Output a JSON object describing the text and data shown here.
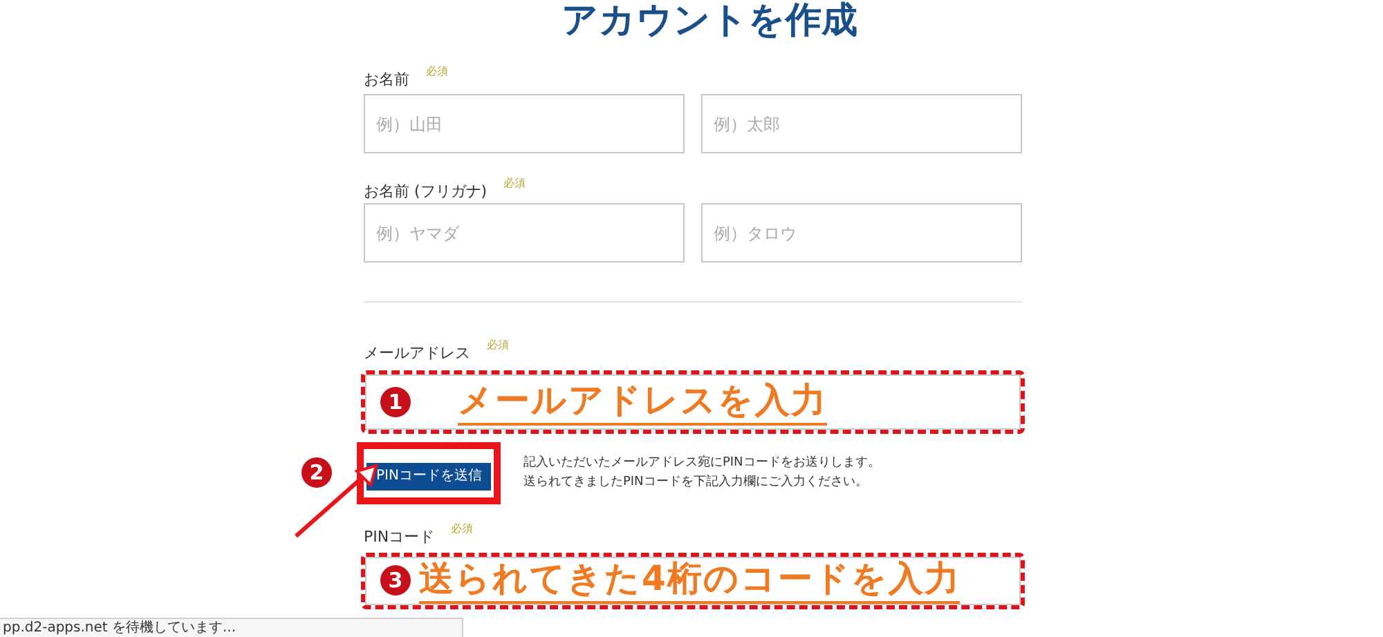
{
  "title": "アカウントを作成",
  "fields": [
    {
      "label": "お名前",
      "required": "必須",
      "inputs": [
        {
          "placeholder": "例）山田"
        },
        {
          "placeholder": "例）太郎"
        }
      ]
    },
    {
      "label": "お名前 (フリガナ)",
      "required": "必須",
      "inputs": [
        {
          "placeholder": "例）ヤマダ"
        },
        {
          "placeholder": "例）タロウ"
        }
      ]
    }
  ],
  "email": {
    "label": "メールアドレス",
    "required": "必須"
  },
  "send_button": {
    "label": "PINコードを送信"
  },
  "help_text": [
    "記入いただいたメールアドレス宛にPINコードをお送りします。",
    "送られてきましたPINコードを下記入力欄にご入力ください。"
  ],
  "pin": {
    "label": "PINコード",
    "required": "必須"
  },
  "annotations": [
    {
      "number": "1",
      "text": "メールアドレスを入力"
    },
    {
      "number": "2"
    },
    {
      "number": "3",
      "text": "送られてきた4桁のコードを入力"
    }
  ],
  "status_bar": "pp.d2-apps.net を待機しています..."
}
